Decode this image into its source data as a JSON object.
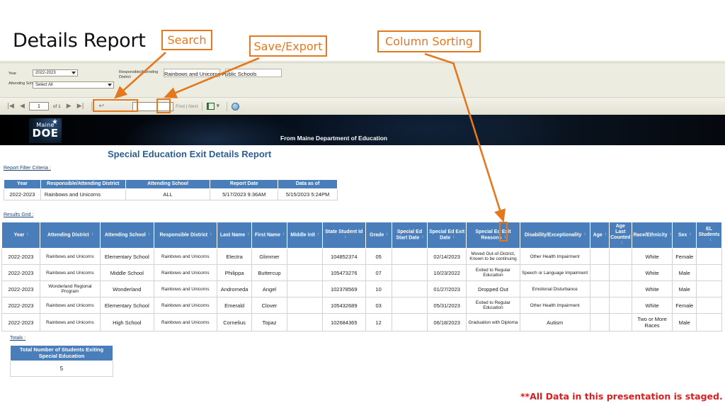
{
  "slide": {
    "title": "Details Report",
    "footnote": "**All Data in this presentation is staged."
  },
  "annotations": {
    "search": "Search",
    "save_export": "Save/Export",
    "column_sorting": "Column Sorting"
  },
  "viewer": {
    "params": {
      "year_label": "Year",
      "year_value": "2022-2023",
      "attending_school_label": "Attending School",
      "attending_school_value": "Select All",
      "district_label": "Responsible/Attending District",
      "district_value": "Rainbows and Unicorns Public Schools"
    },
    "toolbar": {
      "first_icon": "|◀",
      "prev_icon": "◀",
      "page_value": "1",
      "of_text": "of 1",
      "next_icon": "▶",
      "last_icon": "▶|",
      "back_icon": "↩",
      "find_value": "",
      "find_label": "Find | Next",
      "save_icon": "save-icon",
      "refresh_icon": "refresh-icon"
    }
  },
  "banner": {
    "logo_top": "Maine",
    "logo_bottom": "DOE",
    "from_text": "From Maine Department of Education"
  },
  "report": {
    "title": "Special Education Exit Details Report",
    "filter_label": "Report Filter Criteria :",
    "results_label": "Results Grid :",
    "totals_label": "Totals :"
  },
  "filter_table": {
    "headers": [
      "Year",
      "Responsible/Attending District",
      "Attending School",
      "Report Date",
      "Data as of"
    ],
    "row": [
      "2022-2023",
      "Rainbows and Unicorns",
      "ALL",
      "5/17/2023 9:36AM",
      "5/15/2023 5:24PM"
    ]
  },
  "grid": {
    "headers": [
      "Year",
      "Attending District",
      "Attending School",
      "Responsible District",
      "Last Name",
      "First Name",
      "Middle Init",
      "State Student Id",
      "Grade",
      "Special Ed Start Date",
      "Special Ed Exit Date",
      "Special Ed Exit Reasons",
      "Disability/Exceptionality",
      "Age",
      "Age Last Counted",
      "Race/Ethnicity",
      "Sex",
      "EL Students"
    ],
    "rows": [
      [
        "2022-2023",
        "Rainbows and Unicorns",
        "Elementary School",
        "Rainbows and Unicorns",
        "Electra",
        "Glimmer",
        "",
        "104852374",
        "05",
        "",
        "02/14/2023",
        "Moved Out-of-District, Known to be continuing",
        "Other Health Impairment",
        "",
        "",
        "White",
        "Female",
        ""
      ],
      [
        "2022-2023",
        "Rainbows and Unicorns",
        "Middle School",
        "Rainbows and Unicorns",
        "Philippa",
        "Buttercup",
        "",
        "105473276",
        "07",
        "",
        "10/23/2022",
        "Exited to Regular Education",
        "Speech or Language Impairment",
        "",
        "",
        "White",
        "Male",
        ""
      ],
      [
        "2022-2023",
        "Wonderland Regional Program",
        "Wonderland",
        "Rainbows and Unicorns",
        "Andromeda",
        "Angel",
        "",
        "102378569",
        "10",
        "",
        "01/27/2023",
        "Dropped Out",
        "Emotional Disturbance",
        "",
        "",
        "White",
        "Male",
        ""
      ],
      [
        "2022-2023",
        "Rainbows and Unicorns",
        "Elementary School",
        "Rainbows and Unicorns",
        "Emerald",
        "Clover",
        "",
        "105432689",
        "03",
        "",
        "05/31/2023",
        "Exited to Regular Education",
        "Other Health Impairment",
        "",
        "",
        "White",
        "Female",
        ""
      ],
      [
        "2022-2023",
        "Rainbows and Unicorns",
        "High School",
        "Rainbows and Unicorns",
        "Cornelius",
        "Topaz",
        "",
        "102684365",
        "12",
        "",
        "06/18/2023",
        "Graduation with Diploma",
        "Autism",
        "",
        "",
        "Two or More Races",
        "Male",
        ""
      ]
    ]
  },
  "totals_table": {
    "header": "Total Number of Students Exiting Special Education",
    "value": "5"
  },
  "colors": {
    "header_blue": "#4A7EBB",
    "accent_orange": "#E4781E",
    "title_blue": "#2C5F91",
    "warning_red": "#D81F1F"
  }
}
